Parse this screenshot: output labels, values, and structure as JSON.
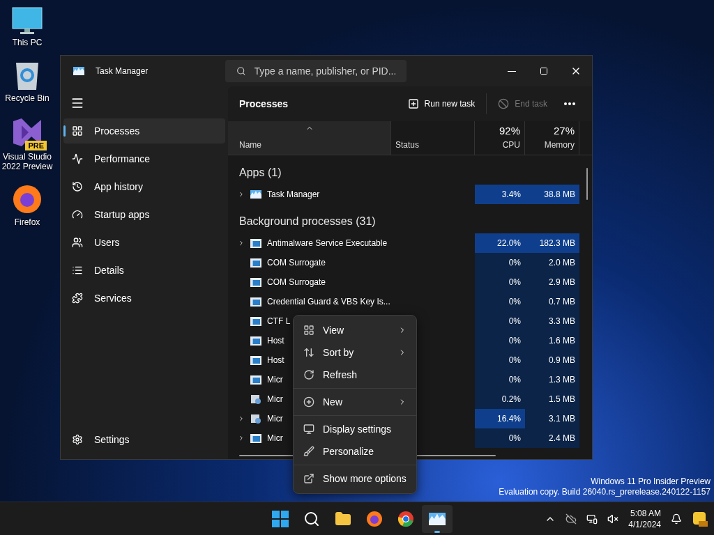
{
  "desktop_icons": [
    {
      "label": "This PC",
      "kind": "pc"
    },
    {
      "label": "Recycle Bin",
      "kind": "bin"
    },
    {
      "label": "Visual Studio 2022 Preview",
      "kind": "vs",
      "badge": "PRE"
    },
    {
      "label": "Firefox",
      "kind": "firefox"
    }
  ],
  "window": {
    "title": "Task Manager",
    "search": {
      "placeholder": "Type a name, publisher, or PID..."
    }
  },
  "sidebar": {
    "items": [
      {
        "label": "Processes",
        "selected": true
      },
      {
        "label": "Performance",
        "selected": false
      },
      {
        "label": "App history",
        "selected": false
      },
      {
        "label": "Startup apps",
        "selected": false
      },
      {
        "label": "Users",
        "selected": false
      },
      {
        "label": "Details",
        "selected": false
      },
      {
        "label": "Services",
        "selected": false
      }
    ],
    "settings": "Settings"
  },
  "toolbar": {
    "title": "Processes",
    "run_new_task": {
      "label": "Run new task",
      "disabled": false
    },
    "end_task": {
      "label": "End task",
      "disabled": true
    }
  },
  "table": {
    "columns": [
      {
        "label": "Name"
      },
      {
        "label": "Status"
      },
      {
        "label": "CPU",
        "total": "92%"
      },
      {
        "label": "Memory",
        "total": "27%"
      }
    ],
    "groups": [
      {
        "label": "Apps (1)",
        "rows": [
          {
            "name": "Task Manager",
            "kind": "taskmgr",
            "expandable": true,
            "cpu": "3.4%",
            "cpu_high": true,
            "memory": "38.8 MB",
            "memory_high": true
          }
        ]
      },
      {
        "label": "Background processes (31)",
        "rows": [
          {
            "name": "Antimalware Service Executable",
            "kind": "app",
            "expandable": true,
            "cpu": "22.0%",
            "cpu_high": true,
            "memory": "182.3 MB",
            "memory_high": true
          },
          {
            "name": "COM Surrogate",
            "kind": "app",
            "expandable": false,
            "cpu": "0%",
            "cpu_high": false,
            "memory": "2.0 MB",
            "memory_high": false
          },
          {
            "name": "COM Surrogate",
            "kind": "app",
            "expandable": false,
            "cpu": "0%",
            "cpu_high": false,
            "memory": "2.9 MB",
            "memory_high": false
          },
          {
            "name": "Credential Guard & VBS Key Is...",
            "kind": "app",
            "expandable": false,
            "cpu": "0%",
            "cpu_high": false,
            "memory": "0.7 MB",
            "memory_high": false
          },
          {
            "name": "CTF L",
            "kind": "app",
            "expandable": false,
            "cpu": "0%",
            "cpu_high": false,
            "memory": "3.3 MB",
            "memory_high": false
          },
          {
            "name": "Host",
            "kind": "app",
            "expandable": false,
            "cpu": "0%",
            "cpu_high": false,
            "memory": "1.6 MB",
            "memory_high": false
          },
          {
            "name": "Host",
            "kind": "app",
            "expandable": false,
            "cpu": "0%",
            "cpu_high": false,
            "memory": "0.9 MB",
            "memory_high": false
          },
          {
            "name": "Micr",
            "kind": "app",
            "expandable": false,
            "cpu": "0%",
            "cpu_high": false,
            "memory": "1.3 MB",
            "memory_high": false
          },
          {
            "name": "Micr",
            "kind": "installer",
            "expandable": false,
            "cpu": "0.2%",
            "cpu_high": false,
            "memory": "1.5 MB",
            "memory_high": false
          },
          {
            "name": "Micr",
            "kind": "installer",
            "expandable": true,
            "cpu": "16.4%",
            "cpu_high": true,
            "memory": "3.1 MB",
            "memory_high": false
          },
          {
            "name": "Micr",
            "kind": "app",
            "expandable": true,
            "cpu": "0%",
            "cpu_high": false,
            "memory": "2.4 MB",
            "memory_high": false
          }
        ]
      }
    ]
  },
  "context_menu": {
    "sections": [
      [
        {
          "label": "View",
          "submenu": true
        },
        {
          "label": "Sort by",
          "submenu": true
        },
        {
          "label": "Refresh",
          "submenu": false
        }
      ],
      [
        {
          "label": "New",
          "submenu": true
        }
      ],
      [
        {
          "label": "Display settings",
          "submenu": false
        },
        {
          "label": "Personalize",
          "submenu": false
        }
      ],
      [
        {
          "label": "Show more options",
          "submenu": false
        }
      ]
    ]
  },
  "watermark": {
    "edition": "Windows 11 Pro Insider Preview",
    "build": "Evaluation copy. Build 26040.rs_prerelease.240122-1157"
  },
  "taskbar": {
    "apps": [
      {
        "kind": "start",
        "active": false
      },
      {
        "kind": "search",
        "active": false
      },
      {
        "kind": "explorer",
        "active": false
      },
      {
        "kind": "firefox",
        "active": false
      },
      {
        "kind": "chrome",
        "active": false
      },
      {
        "kind": "taskmgr",
        "active": true
      }
    ],
    "time": "5:08 AM",
    "date": "4/1/2024"
  }
}
